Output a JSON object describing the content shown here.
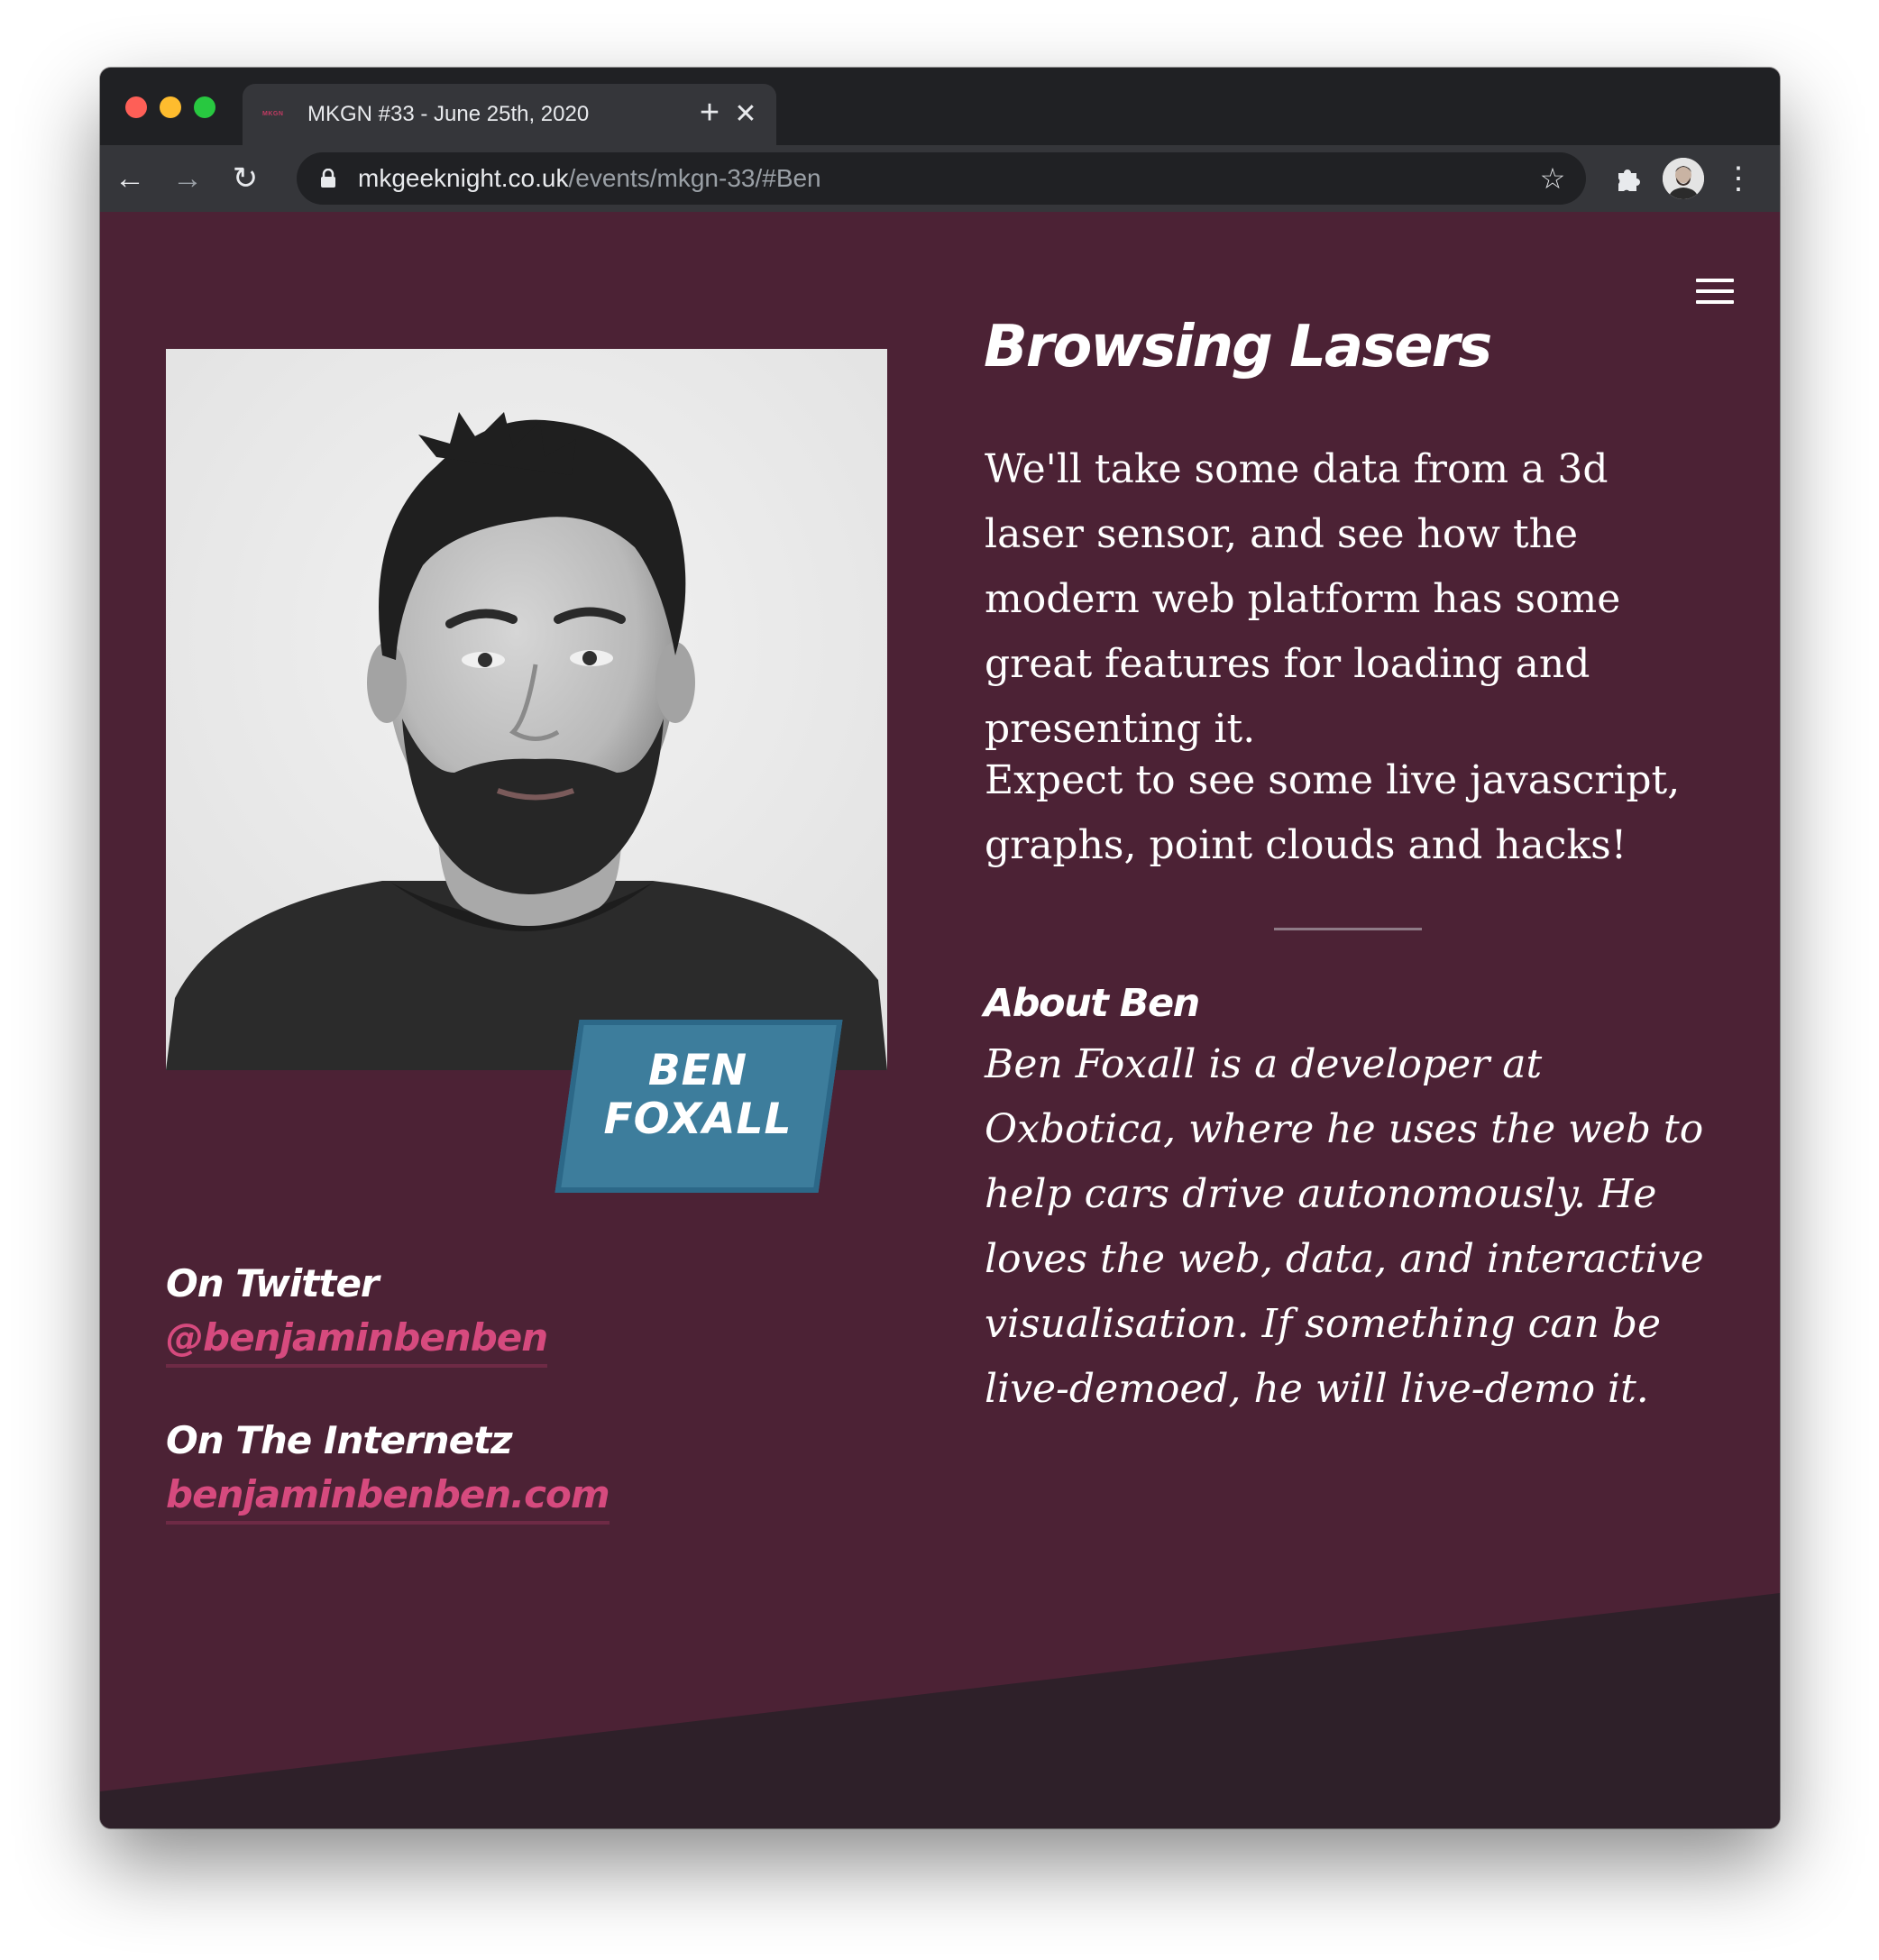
{
  "browser": {
    "tab_title": "MKGN #33 - June 25th, 2020",
    "tab_favicon_text": "MKGN",
    "url_host": "mkgeeknight.co.uk",
    "url_path": "/events/mkgn-33/#Ben",
    "close_glyph": "✕",
    "newtab_glyph": "+",
    "back_glyph": "←",
    "forward_glyph": "→",
    "reload_glyph": "↻",
    "star_glyph": "☆",
    "menu_glyph": "⋮"
  },
  "speaker": {
    "name_line1": "BEN",
    "name_line2": "FOXALL",
    "twitter_label": "On Twitter",
    "twitter_handle": "@benjaminbenben",
    "web_label": "On The Internetz",
    "web_link": "benjaminbenben.com"
  },
  "talk": {
    "title": "Browsing Lasers",
    "paragraph1": "We'll take some data from a 3d laser sensor, and see how the modern web platform has some great features for loading and presenting it.",
    "paragraph2": "Expect to see some live javascript, graphs, point clouds and hacks!",
    "about_heading": "About Ben",
    "about_text": "Ben Foxall is a developer at Oxbotica, where he uses the web to help cars drive autonomously. He loves the web, data, and interactive visualisation. If something can be live-demoed, he will live-demo it."
  },
  "colors": {
    "page_background": "#4c2235",
    "footer_shape": "#2e2029",
    "link_pink": "#d64a7e",
    "badge_blue": "#3d7d9c"
  },
  "icons": [
    "hamburger-menu-icon",
    "lock-icon",
    "star-icon",
    "extensions-puzzle-icon",
    "profile-avatar",
    "more-menu-icon"
  ]
}
